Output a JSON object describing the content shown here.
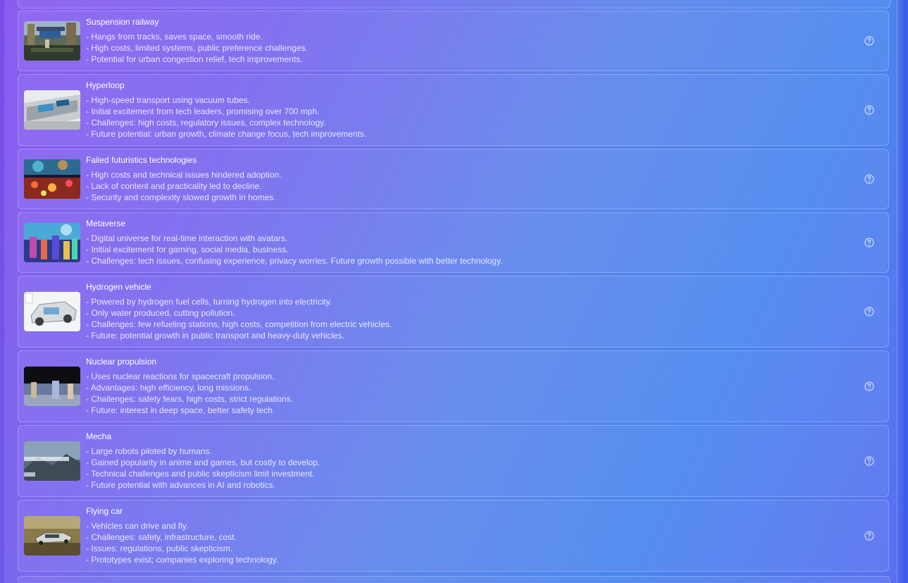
{
  "items": [
    {
      "title": "Suspension railway",
      "thumb_icon": "suspension-railway-photo",
      "lines": [
        "- Hangs from tracks, saves space, smooth ride.",
        "- High costs, limited systems, public preference challenges.",
        "- Potential for urban congestion relief, tech improvements."
      ]
    },
    {
      "title": "Hyperloop",
      "thumb_icon": "hyperloop-photo",
      "lines": [
        "- High-speed transport using vacuum tubes.",
        "- Initial excitement from tech leaders, promising over 700 mph.",
        "- Challenges: high costs, regulatory issues, complex technology.",
        "- Future potential: urban growth, climate change focus, tech improvements."
      ]
    },
    {
      "title": "Failed futuristics technologies",
      "thumb_icon": "failed-tech-photo",
      "lines": [
        "- High costs and technical issues hindered adoption.",
        "- Lack of content and practicality led to decline.",
        "- Security and complexity slowed growth in homes."
      ]
    },
    {
      "title": "Metaverse",
      "thumb_icon": "metaverse-photo",
      "lines": [
        "- Digital universe for real-time interaction with avatars.",
        "- Initial excitement for gaming, social media, business.",
        "- Challenges: tech issues, confusing experience, privacy worries. Future growth possible with better technology."
      ]
    },
    {
      "title": "Hydrogen vehicle",
      "thumb_icon": "hydrogen-vehicle-photo",
      "lines": [
        "- Powered by hydrogen fuel cells, turning hydrogen into electricity.",
        "- Only water produced, cutting pollution.",
        "- Challenges: few refueling stations, high costs, competition from electric vehicles.",
        "- Future: potential growth in public transport and heavy-duty vehicles."
      ]
    },
    {
      "title": "Nuclear propulsion",
      "thumb_icon": "nuclear-propulsion-photo",
      "lines": [
        "- Uses nuclear reactions for spacecraft propulsion.",
        "- Advantages: high efficiency, long missions.",
        "- Challenges: safety fears, high costs, strict regulations.",
        "- Future: interest in deep space, better safety tech."
      ]
    },
    {
      "title": "Mecha",
      "thumb_icon": "mecha-photo",
      "lines": [
        "- Large robots piloted by humans.",
        "- Gained popularity in anime and games, but costly to develop.",
        "- Technical challenges and public skepticism limit investment.",
        "- Future potential with advances in AI and robotics."
      ]
    },
    {
      "title": "Flying car",
      "thumb_icon": "flying-car-photo",
      "lines": [
        "- Vehicles can drive and fly.",
        "- Challenges: safety, infrastructure, cost.",
        "- Issues: regulations, public skepticism.",
        "- Prototypes exist; companies exploring technology."
      ]
    }
  ],
  "help_icon": "question-circle-icon"
}
